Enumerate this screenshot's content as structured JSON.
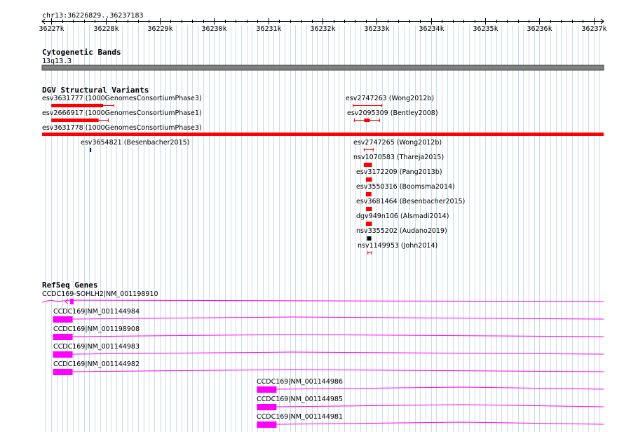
{
  "location": "chr13:36226829..36237183",
  "ruler": {
    "ticks": [
      {
        "label": "36227k",
        "pos": 36227000
      },
      {
        "label": "36228k",
        "pos": 36228000
      },
      {
        "label": "36229k",
        "pos": 36229000
      },
      {
        "label": "36230k",
        "pos": 36230000
      },
      {
        "label": "36231k",
        "pos": 36231000
      },
      {
        "label": "36232k",
        "pos": 36232000
      },
      {
        "label": "36233k",
        "pos": 36233000
      },
      {
        "label": "36234k",
        "pos": 36234000
      },
      {
        "label": "36235k",
        "pos": 36235000
      },
      {
        "label": "36236k",
        "pos": 36236000
      },
      {
        "label": "36237k",
        "pos": 36237000
      }
    ]
  },
  "tracks": {
    "cytoband": {
      "title": "Cytogenetic Bands",
      "band": "13q13.3",
      "color": "#808080"
    },
    "dgv": {
      "title": "DGV Structural Variants",
      "color": "#ff0000",
      "features": [
        {
          "label": "esv3631777 (1000GenomesConsortiumPhase3)",
          "start": 36227000,
          "end": 36228150,
          "style": "bar_whisker"
        },
        {
          "label": "esv2747263 (Wong2012b)",
          "start": 36232560,
          "end": 36233100,
          "style": "whisker"
        },
        {
          "label": "esv2666917 (1000GenomesConsortiumPhase1)",
          "start": 36227000,
          "end": 36228050,
          "style": "bar_whisker"
        },
        {
          "label": "esv2095309 (Bentley2008)",
          "start": 36232580,
          "end": 36233060,
          "style": "whisker_core"
        },
        {
          "label": "esv3631778 (1000GenomesConsortiumPhase3)",
          "start": 36226829,
          "end": 36237183,
          "style": "bar"
        },
        {
          "label": "esv3654821 (Besenbacher2015)",
          "start": 36227710,
          "end": 36227740,
          "style": "tick",
          "color": "#0000aa"
        },
        {
          "label": "esv2747265 (Wong2012b)",
          "start": 36232760,
          "end": 36232940,
          "style": "whisker"
        },
        {
          "label": "nsv1070583 (Thareja2015)",
          "start": 36232760,
          "end": 36232910,
          "style": "block"
        },
        {
          "label": "esv3172209 (Pang2013b)",
          "start": 36232800,
          "end": 36232910,
          "style": "block"
        },
        {
          "label": "esv3550316 (Boomsma2014)",
          "start": 36232800,
          "end": 36232900,
          "style": "block"
        },
        {
          "label": "esv3681464 (Besenbacher2015)",
          "start": 36232800,
          "end": 36232910,
          "style": "block"
        },
        {
          "label": "dgv949n106 (Alsmadi2014)",
          "start": 36232800,
          "end": 36232910,
          "style": "block"
        },
        {
          "label": "nsv3355202 (Audano2019)",
          "start": 36232820,
          "end": 36232890,
          "style": "block",
          "color": "#000000"
        },
        {
          "label": "nsv1149953 (John2014)",
          "start": 36232830,
          "end": 36232910,
          "style": "whisker"
        }
      ]
    },
    "refseq": {
      "title": "RefSeq Genes",
      "color": "#ff00ff",
      "features": [
        {
          "label": "CCDC169-SOHLH2|NM_001198910",
          "start": 36226829,
          "end": 36237183,
          "style": "first"
        },
        {
          "label": "CCDC169|NM_001144984",
          "start": 36227030,
          "end": 36237183,
          "style": "gene"
        },
        {
          "label": "CCDC169|NM_001198908",
          "start": 36227030,
          "end": 36237183,
          "style": "gene"
        },
        {
          "label": "CCDC169|NM_001144983",
          "start": 36227030,
          "end": 36237183,
          "style": "gene"
        },
        {
          "label": "CCDC169|NM_001144982",
          "start": 36227030,
          "end": 36237183,
          "style": "gene"
        },
        {
          "label": "CCDC169|NM_001144986",
          "start": 36230790,
          "end": 36237183,
          "style": "gene"
        },
        {
          "label": "CCDC169|NM_001144985",
          "start": 36230790,
          "end": 36237183,
          "style": "gene"
        },
        {
          "label": "CCDC169|NM_001144981",
          "start": 36230790,
          "end": 36237183,
          "style": "gene"
        }
      ]
    }
  }
}
